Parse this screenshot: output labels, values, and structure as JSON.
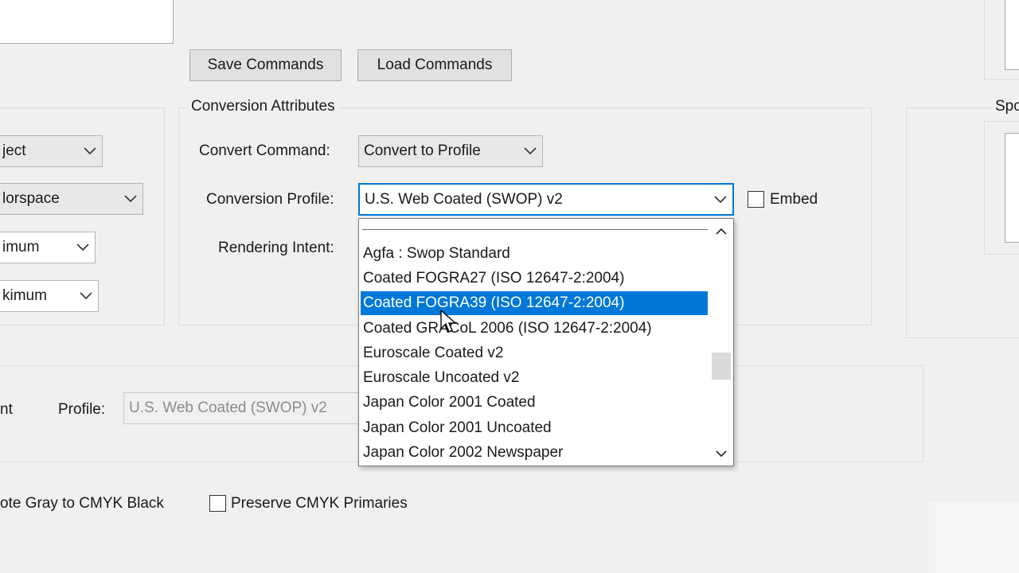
{
  "commands": {
    "save_label": "Save Commands",
    "load_label": "Load Commands"
  },
  "left_panel": {
    "combo1_value": "ject",
    "combo2_value": "lorspace",
    "combo3_value": "imum",
    "combo4_value": "kimum"
  },
  "conversion": {
    "group_label": "Conversion Attributes",
    "convert_command_label": "Convert Command:",
    "convert_command_value": "Convert to Profile",
    "conversion_profile_label": "Conversion Profile:",
    "conversion_profile_value": "U.S. Web Coated (SWOP) v2",
    "embed_label": "Embed",
    "embed_checked": false,
    "rendering_intent_label": "Rendering Intent:"
  },
  "profile_dropdown": {
    "items": [
      "Agfa : Swop Standard",
      "Coated FOGRA27 (ISO 12647-2:2004)",
      "Coated FOGRA39 (ISO 12647-2:2004)",
      "Coated GRACoL 2006 (ISO 12647-2:2004)",
      "Euroscale Coated v2",
      "Euroscale Uncoated v2",
      "Japan Color 2001 Coated",
      "Japan Color 2001 Uncoated",
      "Japan Color 2002 Newspaper"
    ],
    "selected_index": 2
  },
  "lower": {
    "left_partial_label": "nt",
    "profile_label": "Profile:",
    "profile_value": "U.S. Web Coated (SWOP) v2",
    "promote_gray_label": "ote Gray to CMYK Black",
    "preserve_cmyk_label": "Preserve CMYK Primaries",
    "preserve_cmyk_checked": false
  },
  "right_panel": {
    "partial_label": "Spo"
  },
  "colors": {
    "accent": "#0078d7",
    "background": "#f0f0f0",
    "selection_text": "#ffffff"
  }
}
